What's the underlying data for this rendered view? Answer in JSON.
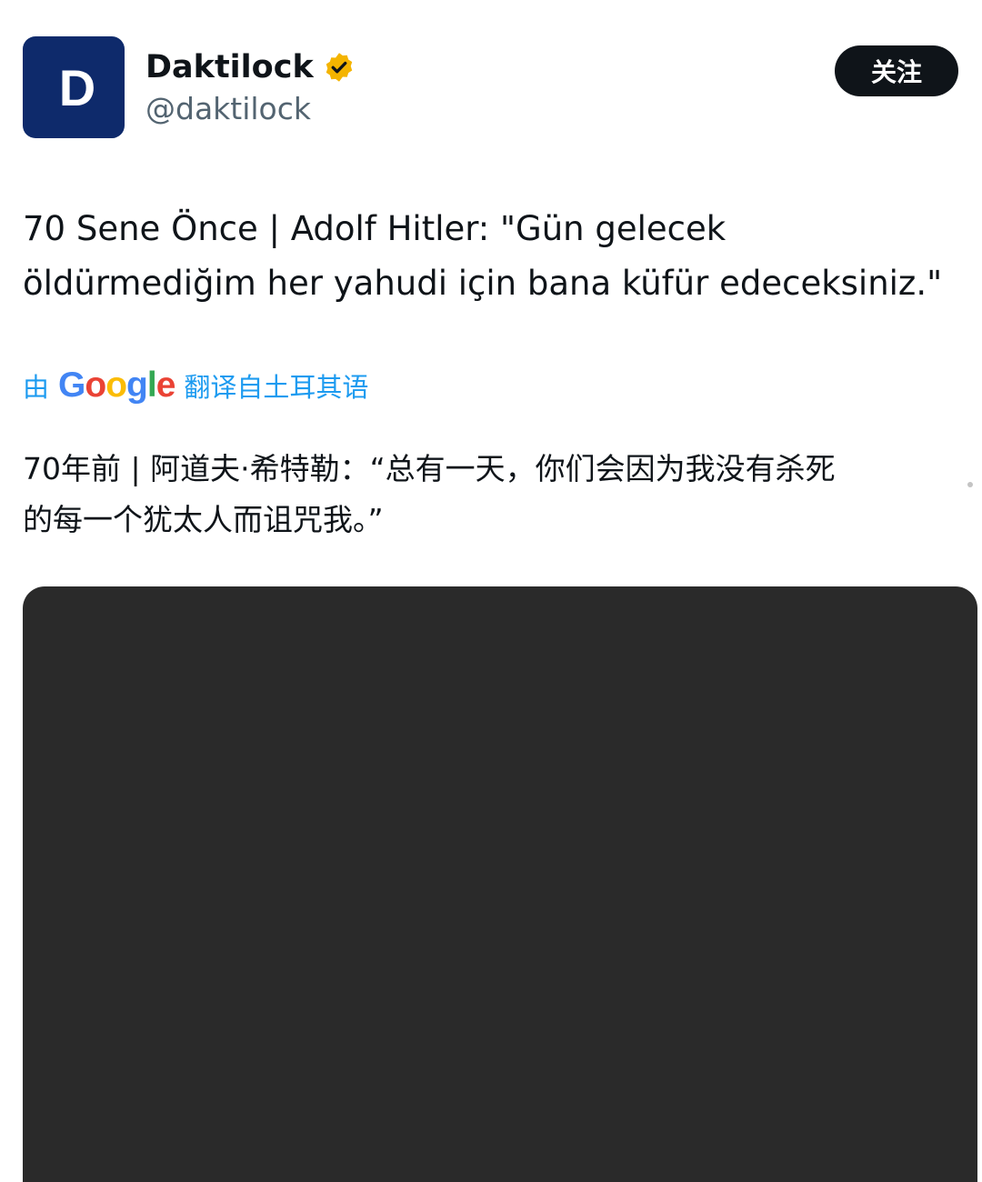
{
  "author": {
    "avatar_icon": "daktilock-logo-icon",
    "avatar_text": "D",
    "display_name": "Daktilock",
    "verified_icon": "verified-badge-icon",
    "handle": "@daktilock"
  },
  "follow_label": "关注",
  "tweet": {
    "text": "70 Sene Önce | Adolf Hitler: \"Gün gelecek\nöldürmediğim her yahudi için bana küfür edeceksiniz.\""
  },
  "translation": {
    "prefix": "由",
    "provider": "Google",
    "suffix": "翻译自土耳其语",
    "text": "70年前 | 阿道夫·希特勒：“总有一天，你们会因为我没有杀死\n的每一个犹太人而诅咒我。”"
  },
  "colors": {
    "avatar_bg": "#0e2a6b",
    "verified_badge": "#f4b400",
    "link_blue": "#1d9bf0",
    "follow_bg": "#0f1419"
  }
}
